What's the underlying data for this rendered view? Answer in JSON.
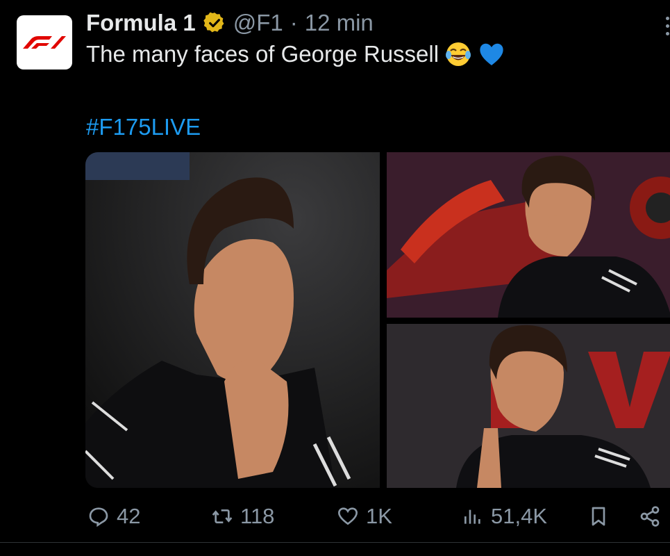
{
  "tweet": {
    "author_name": "Formula 1",
    "handle": "@F1",
    "separator": "·",
    "time": "12 min",
    "text": "The many faces of George Russell",
    "hashtag": "#F175LIVE"
  },
  "actions": {
    "reply_count": "42",
    "retweet_count": "118",
    "like_count": "1K",
    "view_count": "51,4K"
  },
  "icons": {
    "avatar": "f1-logo-icon",
    "verified": "verified-badge-icon",
    "reply": "reply-icon",
    "retweet": "retweet-icon",
    "like": "heart-icon",
    "views": "analytics-icon",
    "bookmark": "bookmark-icon",
    "share": "share-icon"
  },
  "colors": {
    "background": "#000000",
    "text": "#e7e9ea",
    "muted": "#8b98a5",
    "link": "#1d9bf0",
    "verified": "#e2b719",
    "f1_red": "#e10600"
  }
}
